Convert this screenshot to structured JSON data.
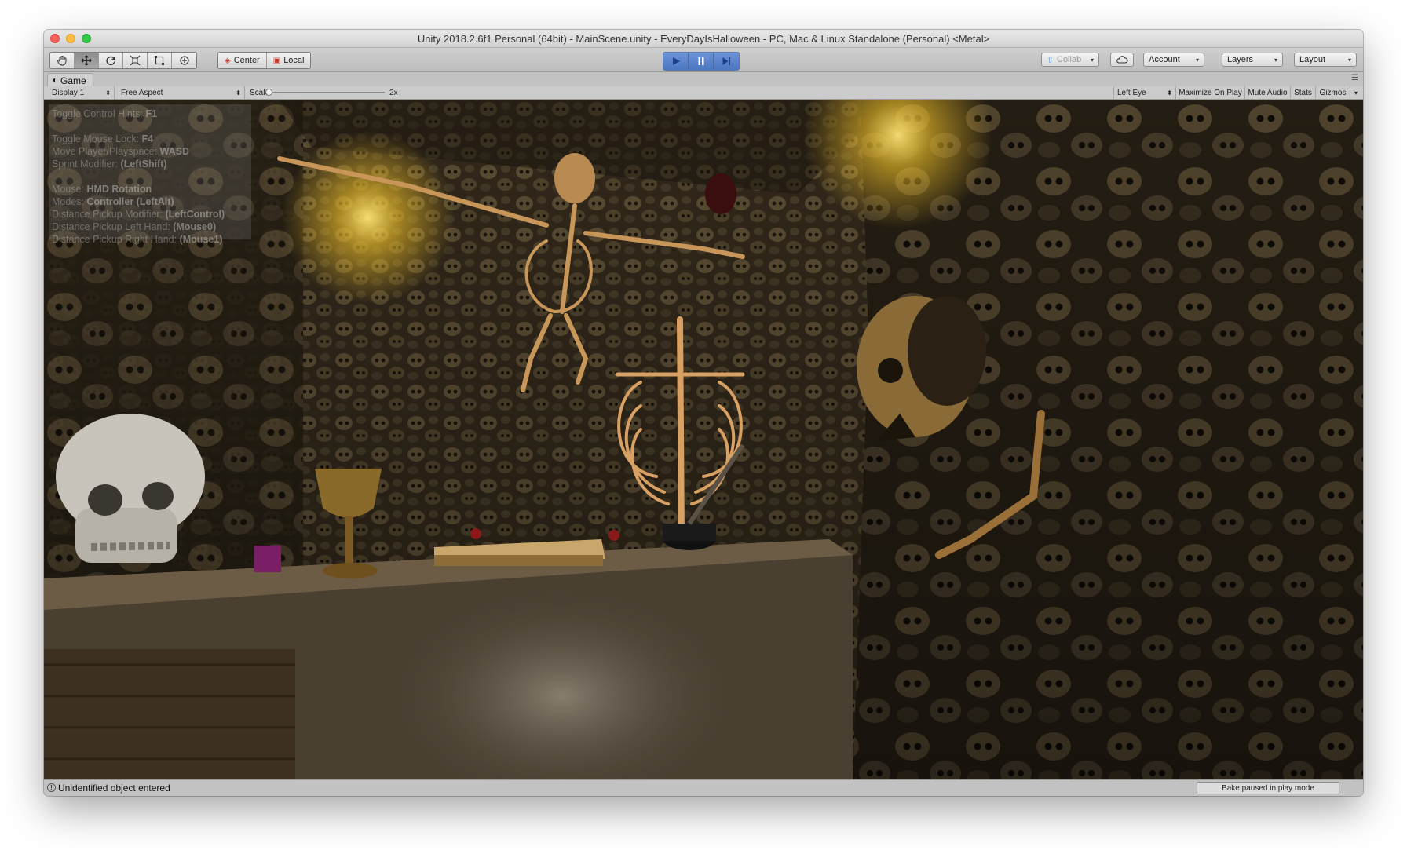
{
  "window": {
    "title": "Unity 2018.2.6f1 Personal (64bit) - MainScene.unity - EveryDayIsHalloween - PC, Mac & Linux Standalone (Personal) <Metal>"
  },
  "toolbar": {
    "pivot_label": "Center",
    "space_label": "Local",
    "collab_label": "Collab",
    "account_label": "Account",
    "layers_label": "Layers",
    "layout_label": "Layout"
  },
  "game_tab": {
    "label": "Game"
  },
  "game_bar": {
    "display": "Display 1",
    "aspect": "Free Aspect",
    "scale_label": "Scale",
    "scale_value": "2x",
    "eye": "Left Eye",
    "maximize": "Maximize On Play",
    "mute": "Mute Audio",
    "stats": "Stats",
    "gizmos": "Gizmos"
  },
  "hints": {
    "line1_text": "Toggle Control Hints: ",
    "line1_key": "F1",
    "line2_text": "Toggle Mouse Lock: ",
    "line2_key": "F4",
    "line3_text": "Move Player/Playspace: ",
    "line3_key": "WASD",
    "line4_text": "Sprint Modifier: ",
    "line4_key": "(LeftShift)",
    "line5_text": "Mouse: ",
    "line5_key": "HMD Rotation",
    "line6_text": "Modes: ",
    "line6_key": "Controller (LeftAlt)",
    "line7_text": "Distance Pickup Modifier: ",
    "line7_key": "(LeftControl)",
    "line8_text": "Distance Pickup Left Hand: ",
    "line8_key": "(Mouse0)",
    "line9_text": "Distance Pickup Right Hand: ",
    "line9_key": "(Mouse1)"
  },
  "status": {
    "message": "Unidentified object entered",
    "bake": "Bake paused in play mode"
  },
  "colors": {
    "play_accent": "#4b76c2",
    "wall_dark": "#2c2317",
    "torch_glow": "#f2c22a"
  }
}
